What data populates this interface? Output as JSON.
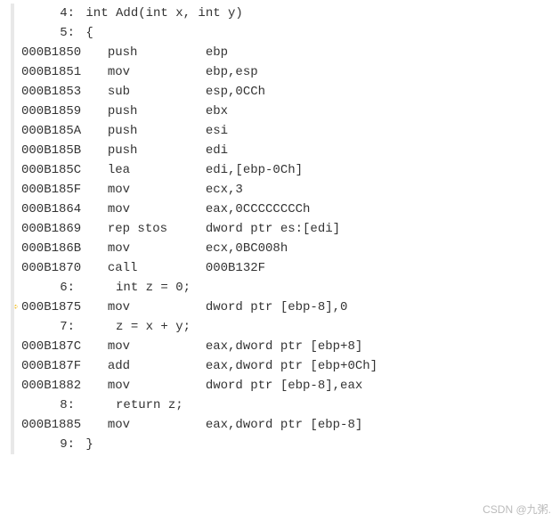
{
  "lines": [
    {
      "type": "src",
      "num": "4:",
      "text": "int Add(int x, int y)"
    },
    {
      "type": "src",
      "num": "5:",
      "text": "{"
    },
    {
      "type": "asm",
      "addr": "000B1850",
      "instr": "push",
      "ops": "ebp"
    },
    {
      "type": "asm",
      "addr": "000B1851",
      "instr": "mov",
      "ops": "ebp,esp"
    },
    {
      "type": "asm",
      "addr": "000B1853",
      "instr": "sub",
      "ops": "esp,0CCh"
    },
    {
      "type": "asm",
      "addr": "000B1859",
      "instr": "push",
      "ops": "ebx"
    },
    {
      "type": "asm",
      "addr": "000B185A",
      "instr": "push",
      "ops": "esi"
    },
    {
      "type": "asm",
      "addr": "000B185B",
      "instr": "push",
      "ops": "edi"
    },
    {
      "type": "asm",
      "addr": "000B185C",
      "instr": "lea",
      "ops": "edi,[ebp-0Ch]"
    },
    {
      "type": "asm",
      "addr": "000B185F",
      "instr": "mov",
      "ops": "ecx,3"
    },
    {
      "type": "asm",
      "addr": "000B1864",
      "instr": "mov",
      "ops": "eax,0CCCCCCCCh"
    },
    {
      "type": "asm",
      "addr": "000B1869",
      "instr": "rep stos",
      "ops": "dword ptr es:[edi]"
    },
    {
      "type": "asm",
      "addr": "000B186B",
      "instr": "mov",
      "ops": "ecx,0BC008h"
    },
    {
      "type": "asm",
      "addr": "000B1870",
      "instr": "call",
      "ops": "000B132F"
    },
    {
      "type": "src",
      "num": "6:",
      "text": "    int z = 0;"
    },
    {
      "type": "asm",
      "addr": "000B1875",
      "instr": "mov",
      "ops": "dword ptr [ebp-8],0",
      "current": true
    },
    {
      "type": "src",
      "num": "7:",
      "text": "    z = x + y;"
    },
    {
      "type": "asm",
      "addr": "000B187C",
      "instr": "mov",
      "ops": "eax,dword ptr [ebp+8]"
    },
    {
      "type": "asm",
      "addr": "000B187F",
      "instr": "add",
      "ops": "eax,dword ptr [ebp+0Ch]"
    },
    {
      "type": "asm",
      "addr": "000B1882",
      "instr": "mov",
      "ops": "dword ptr [ebp-8],eax"
    },
    {
      "type": "src",
      "num": "8:",
      "text": "    return z;"
    },
    {
      "type": "asm",
      "addr": "000B1885",
      "instr": "mov",
      "ops": "eax,dword ptr [ebp-8]"
    },
    {
      "type": "src",
      "num": "9:",
      "text": "}"
    }
  ],
  "watermark": "CSDN @九粥."
}
